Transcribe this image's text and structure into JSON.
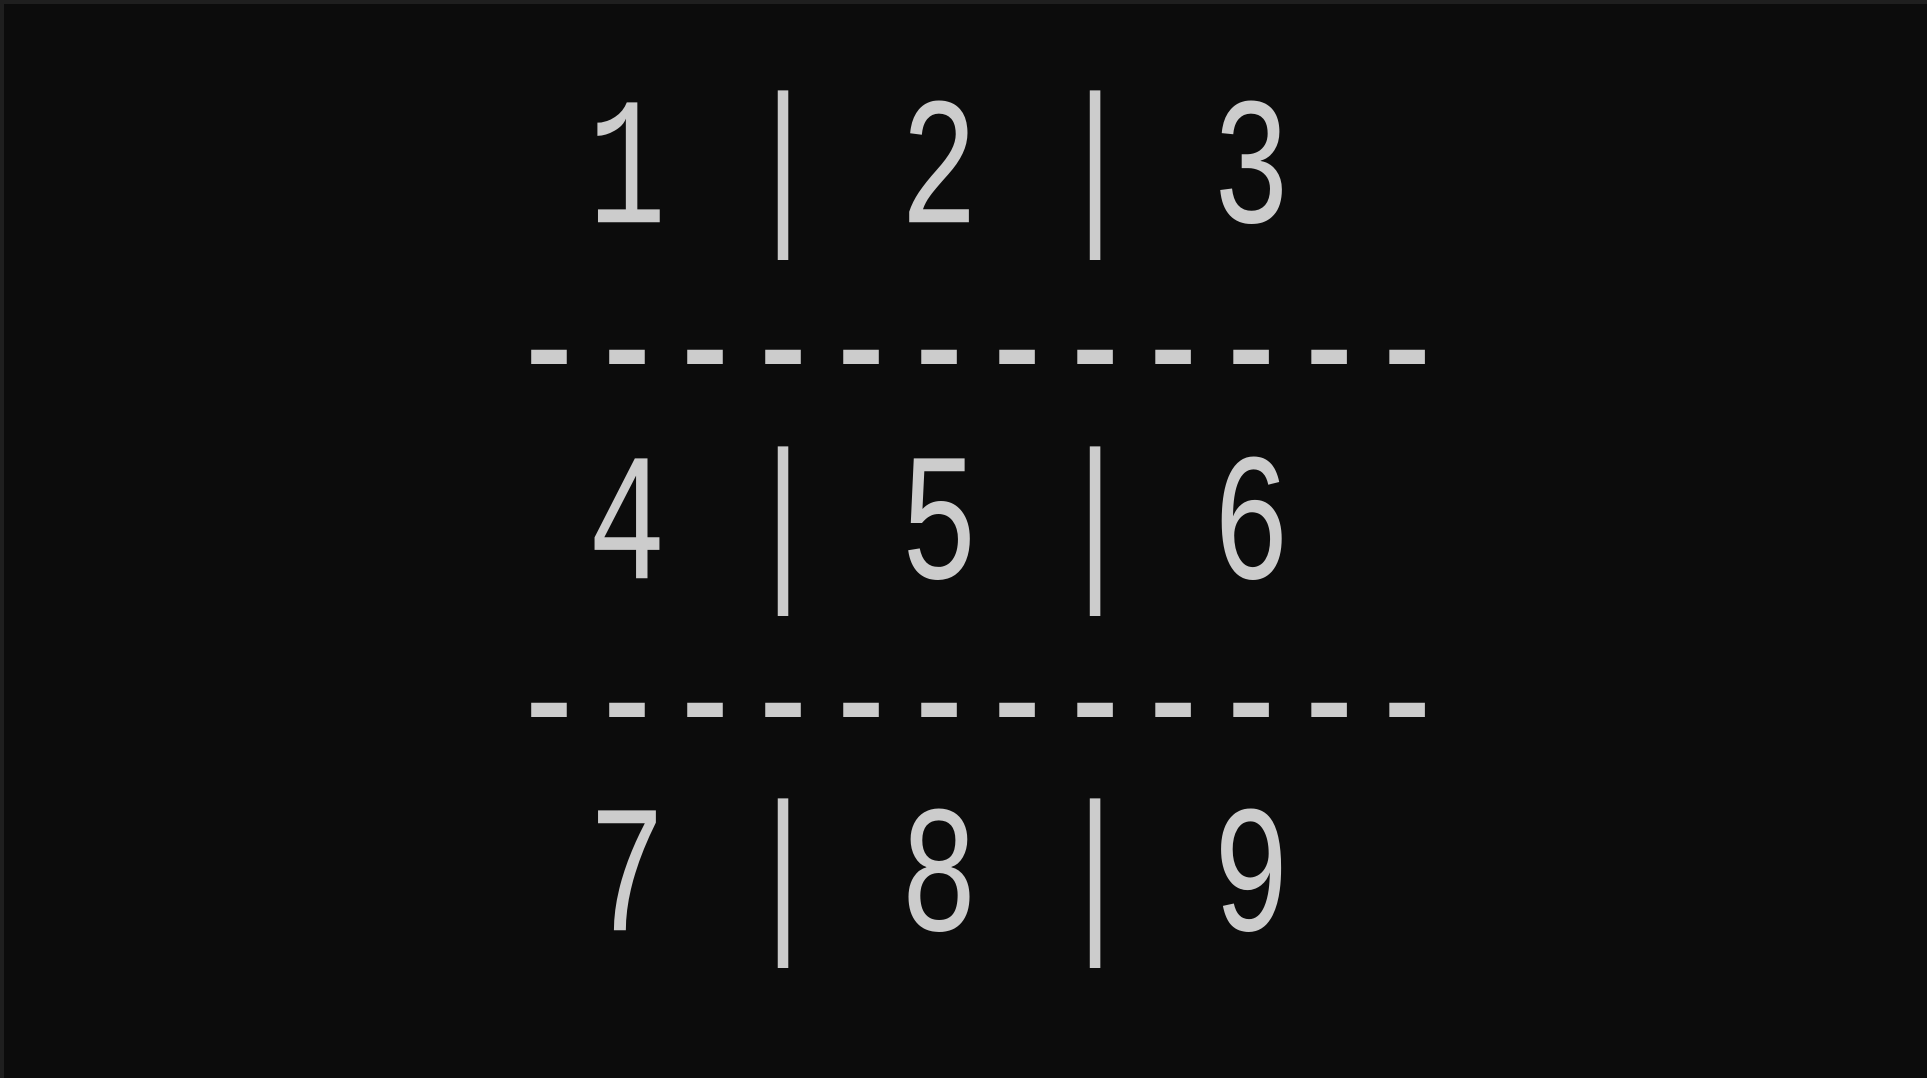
{
  "console": {
    "lines": [
      " 1 | 2 | 3",
      "------------",
      " 4 | 5 | 6",
      "------------",
      " 7 | 8 | 9"
    ]
  },
  "colors": {
    "background": "#0c0c0c",
    "text": "#cccccc"
  }
}
